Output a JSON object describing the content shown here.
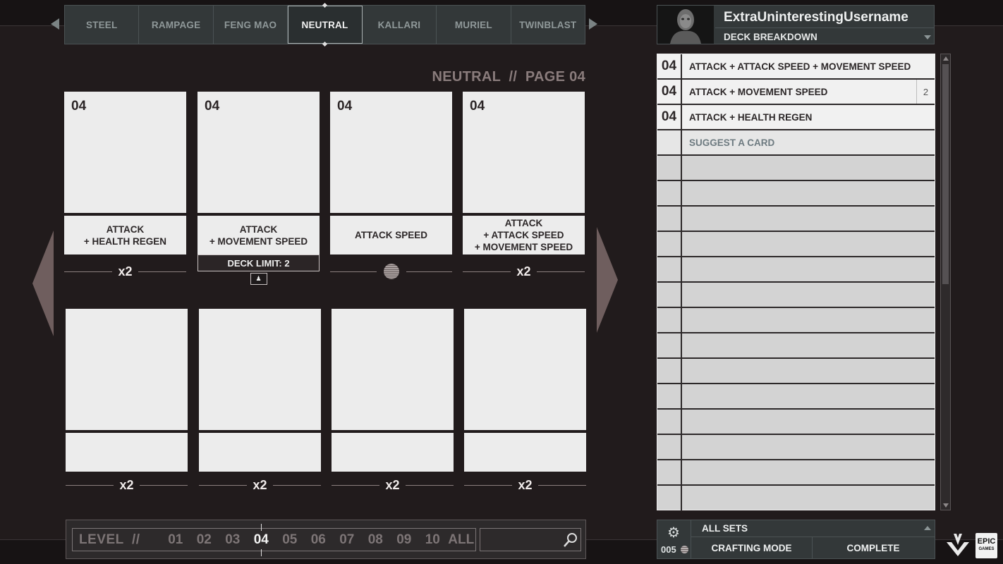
{
  "heroes": [
    "STEEL",
    "RAMPAGE",
    "FENG MAO",
    "NEUTRAL",
    "KALLARI",
    "MURIEL",
    "TWINBLAST"
  ],
  "active_hero_index": 3,
  "page_heading": "NEUTRAL  //  PAGE 04",
  "cards_top": [
    {
      "cost": "04",
      "name": "ATTACK\n+ HEALTH REGEN",
      "count": "x2"
    },
    {
      "cost": "04",
      "name": "ATTACK\n+ MOVEMENT SPEED",
      "deck_limit": "DECK LIMIT: 2"
    },
    {
      "cost": "04",
      "name": "ATTACK SPEED"
    },
    {
      "cost": "04",
      "name": "ATTACK\n+ ATTACK SPEED\n+ MOVEMENT SPEED",
      "count": "x2"
    }
  ],
  "cards_bottom": [
    {
      "count": "x2"
    },
    {
      "count": "x2"
    },
    {
      "count": "x2"
    },
    {
      "count": "x2"
    }
  ],
  "level_bar": {
    "label": "LEVEL  //",
    "levels": [
      "01",
      "02",
      "03",
      "04",
      "05",
      "06",
      "07",
      "08",
      "09",
      "10",
      "ALL"
    ],
    "active": "04",
    "search_placeholder": ""
  },
  "profile": {
    "username": "ExtraUninterestingUsername",
    "view_label": "DECK BREAKDOWN"
  },
  "deck_list": [
    {
      "cost": "04",
      "name": "ATTACK + ATTACK SPEED + MOVEMENT SPEED",
      "qty": ""
    },
    {
      "cost": "04",
      "name": "ATTACK + MOVEMENT SPEED",
      "qty": "2"
    },
    {
      "cost": "04",
      "name": "ATTACK + HEALTH REGEN",
      "qty": ""
    },
    {
      "cost": "",
      "name": "SUGGEST A CARD",
      "qty": ""
    }
  ],
  "empty_deck_rows": 14,
  "bottom": {
    "card_count": "005",
    "set_filter": "ALL SETS",
    "crafting_label": "CRAFTING MODE",
    "complete_label": "COMPLETE"
  },
  "logos": {
    "epic_top": "EPIC",
    "epic_bottom": "GAMES"
  },
  "colors": {
    "background": "#171314",
    "card": "#ececec",
    "tab_bar": "#333839",
    "accent_text": "#8a7c7c"
  }
}
